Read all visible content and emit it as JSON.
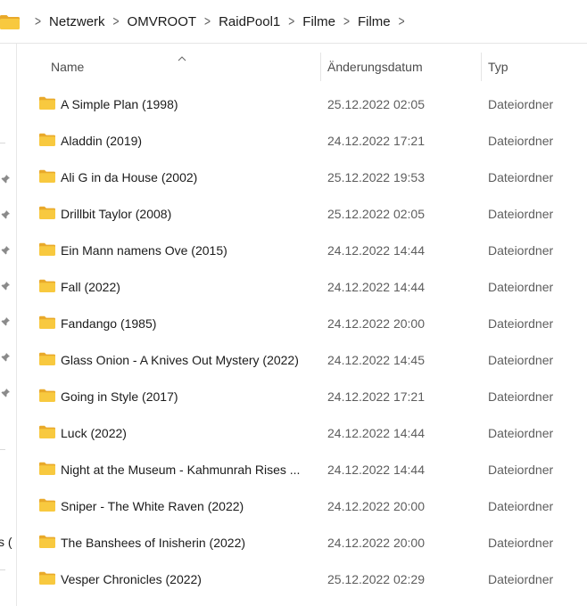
{
  "breadcrumb": {
    "items": [
      "Netzwerk",
      "OMVROOT",
      "RaidPool1",
      "Filme",
      "Filme"
    ]
  },
  "left_pane": {
    "fragment_text": "s ("
  },
  "columns": {
    "name": "Name",
    "date": "Änderungsdatum",
    "type": "Typ"
  },
  "rows": [
    {
      "name": "A Simple Plan (1998)",
      "date": "25.12.2022 02:05",
      "type": "Dateiordner"
    },
    {
      "name": "Aladdin (2019)",
      "date": "24.12.2022 17:21",
      "type": "Dateiordner"
    },
    {
      "name": "Ali G in da House (2002)",
      "date": "25.12.2022 19:53",
      "type": "Dateiordner"
    },
    {
      "name": "Drillbit Taylor (2008)",
      "date": "25.12.2022 02:05",
      "type": "Dateiordner"
    },
    {
      "name": "Ein Mann namens Ove (2015)",
      "date": "24.12.2022 14:44",
      "type": "Dateiordner"
    },
    {
      "name": "Fall (2022)",
      "date": "24.12.2022 14:44",
      "type": "Dateiordner"
    },
    {
      "name": "Fandango (1985)",
      "date": "24.12.2022 20:00",
      "type": "Dateiordner"
    },
    {
      "name": "Glass Onion - A Knives Out Mystery (2022)",
      "date": "24.12.2022 14:45",
      "type": "Dateiordner"
    },
    {
      "name": "Going in Style (2017)",
      "date": "24.12.2022 17:21",
      "type": "Dateiordner"
    },
    {
      "name": "Luck (2022)",
      "date": "24.12.2022 14:44",
      "type": "Dateiordner"
    },
    {
      "name": "Night at the Museum - Kahmunrah Rises ...",
      "date": "24.12.2022 14:44",
      "type": "Dateiordner"
    },
    {
      "name": "Sniper - The White Raven (2022)",
      "date": "24.12.2022 20:00",
      "type": "Dateiordner"
    },
    {
      "name": "The Banshees of Inisherin (2022)",
      "date": "24.12.2022 20:00",
      "type": "Dateiordner"
    },
    {
      "name": "Vesper Chronicles (2022)",
      "date": "25.12.2022 02:29",
      "type": "Dateiordner"
    }
  ],
  "icons": {
    "folder": "folder-icon",
    "chevron": "chevron-right-icon",
    "pin": "pin-icon",
    "sort": "sort-ascending-icon"
  },
  "colors": {
    "folder_body": "#f8c93f",
    "folder_tab": "#e9a92a",
    "date_text": "#5d5d5d"
  }
}
